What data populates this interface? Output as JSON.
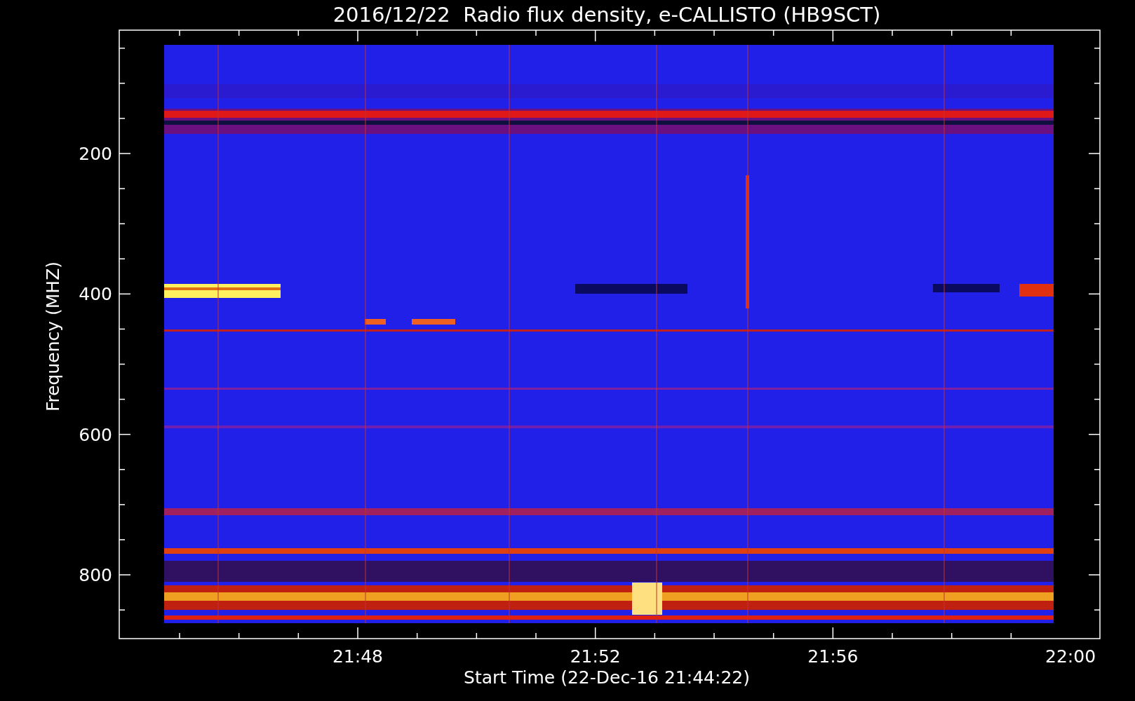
{
  "title": "2016/12/22  Radio flux density, e-CALLISTO (HB9SCT)",
  "y_axis": {
    "label": "Frequency (MHZ)",
    "ticks": [
      "200",
      "400",
      "600",
      "800"
    ]
  },
  "x_axis": {
    "label": "Start Time (22-Dec-16 21:44:22)",
    "ticks": [
      "21:48",
      "21:52",
      "21:56",
      "22:00"
    ]
  }
}
